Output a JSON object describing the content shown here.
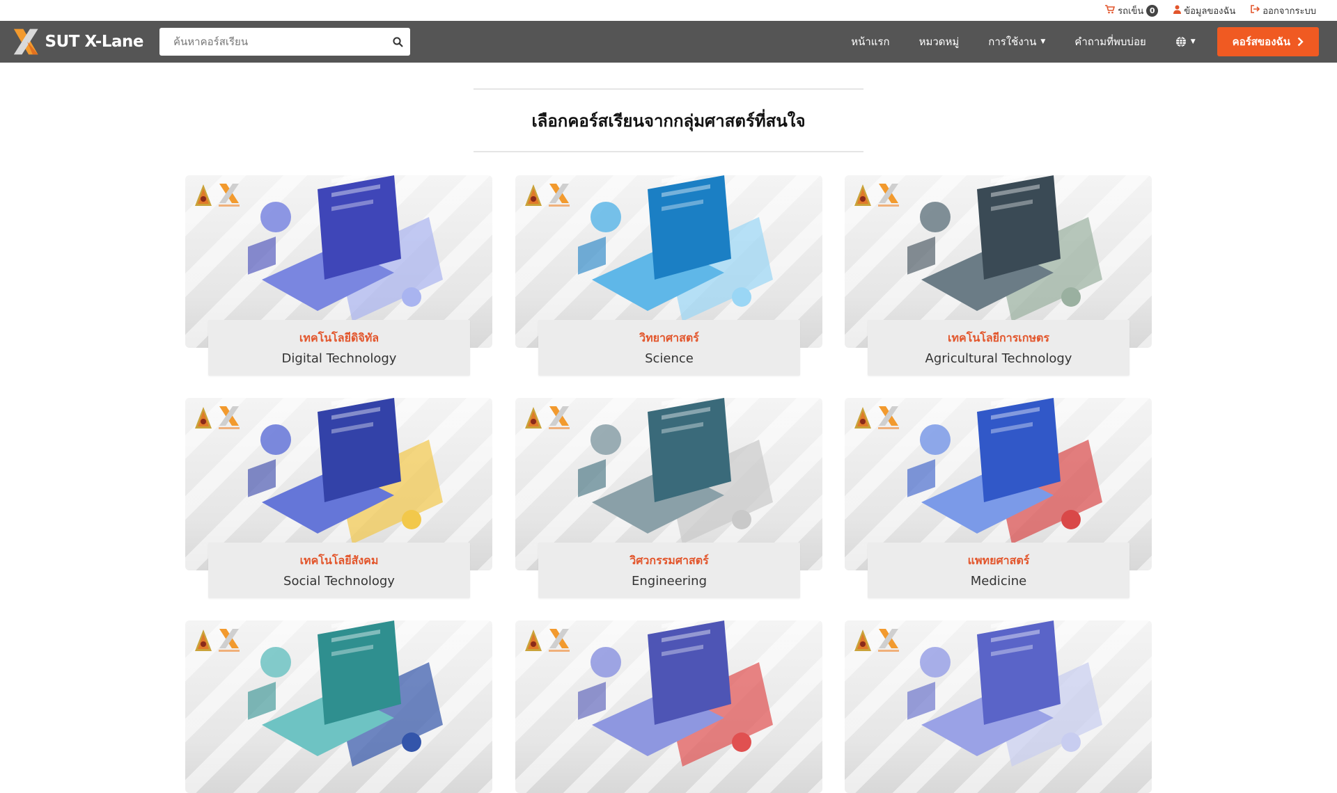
{
  "topbar": {
    "cart_label": "รถเข็น",
    "cart_count": "0",
    "profile_label": "ข้อมูลของฉัน",
    "logout_label": "ออกจากระบบ"
  },
  "brand": {
    "name": "SUT X-Lane"
  },
  "search": {
    "placeholder": "ค้นหาคอร์สเรียน",
    "value": ""
  },
  "nav": {
    "home": "หน้าแรก",
    "categories": "หมวดหมู่",
    "usage": "การใช้งาน",
    "faq": "คำถามที่พบบ่อย",
    "my_courses": "คอร์สของฉัน"
  },
  "colors": {
    "accent": "#f05a22",
    "navbar": "#555555",
    "category_text": "#e2552b"
  },
  "main": {
    "heading": "เลือกคอร์สเรียนจากกลุ่มศาสตร์ที่สนใจ",
    "categories": [
      {
        "th": "เทคโนโลยีดิจิทัล",
        "en": "Digital Technology",
        "icon": "laptop-code-illustration"
      },
      {
        "th": "วิทยาศาสตร์",
        "en": "Science",
        "icon": "science-lab-illustration"
      },
      {
        "th": "เทคโนโลยีการเกษตร",
        "en": "Agricultural Technology",
        "icon": "agri-drone-illustration"
      },
      {
        "th": "เทคโนโลยีสังคม",
        "en": "Social Technology",
        "icon": "social-media-illustration"
      },
      {
        "th": "วิศวกรรมศาสตร์",
        "en": "Engineering",
        "icon": "engineering-illustration"
      },
      {
        "th": "แพทยศาสตร์",
        "en": "Medicine",
        "icon": "medicine-illustration"
      },
      {
        "th": "",
        "en": "",
        "icon": "nursing-staff-illustration"
      },
      {
        "th": "",
        "en": "",
        "icon": "dentistry-illustration"
      },
      {
        "th": "",
        "en": "",
        "icon": "public-health-illustration"
      }
    ]
  }
}
